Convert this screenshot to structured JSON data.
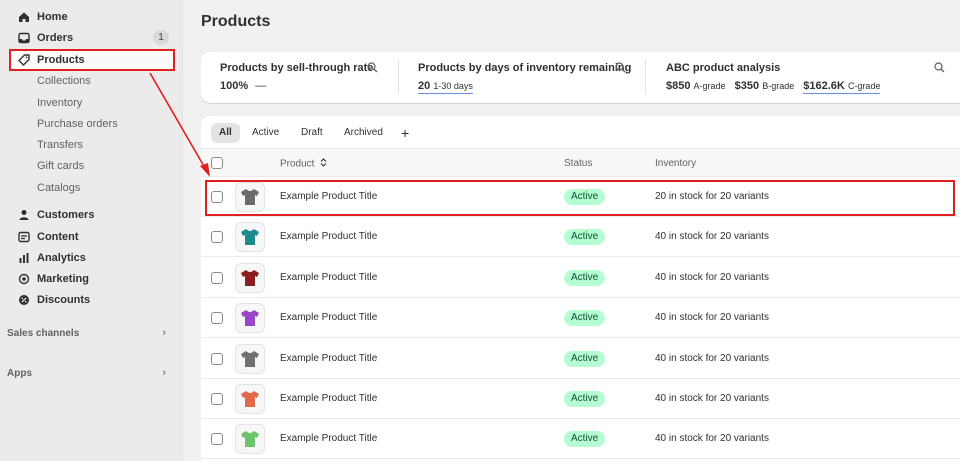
{
  "sidebar": {
    "home": "Home",
    "orders": "Orders",
    "orders_badge": "1",
    "products": "Products",
    "collections": "Collections",
    "inventory": "Inventory",
    "purchase_orders": "Purchase orders",
    "transfers": "Transfers",
    "gift_cards": "Gift cards",
    "catalogs": "Catalogs",
    "customers": "Customers",
    "content": "Content",
    "analytics": "Analytics",
    "marketing": "Marketing",
    "discounts": "Discounts",
    "sales_channels": "Sales channels",
    "apps": "Apps"
  },
  "page": {
    "title": "Products"
  },
  "metrics": {
    "sell_through": {
      "title": "Products by sell-through rate",
      "value": "100%",
      "trend": "—"
    },
    "days_inventory": {
      "title": "Products by days of inventory remaining",
      "value": "20",
      "range": "1-30 days"
    },
    "abc": {
      "title": "ABC product analysis",
      "a_value": "$850",
      "a_label": "A-grade",
      "b_value": "$350",
      "b_label": "B-grade",
      "c_value": "$162.6K",
      "c_label": "C-grade"
    }
  },
  "tabs": [
    "All",
    "Active",
    "Draft",
    "Archived"
  ],
  "tab_add": "+",
  "columns": {
    "product": "Product",
    "status": "Status",
    "inventory": "Inventory"
  },
  "rows": [
    {
      "title": "Example Product Title",
      "status": "Active",
      "inventory": "20 in stock for 20 variants",
      "color": "#6b6b6b"
    },
    {
      "title": "Example Product Title",
      "status": "Active",
      "inventory": "40 in stock for 20 variants",
      "color": "#1a8c8c"
    },
    {
      "title": "Example Product Title",
      "status": "Active",
      "inventory": "40 in stock for 20 variants",
      "color": "#8b1e1e"
    },
    {
      "title": "Example Product Title",
      "status": "Active",
      "inventory": "40 in stock for 20 variants",
      "color": "#9b45c9"
    },
    {
      "title": "Example Product Title",
      "status": "Active",
      "inventory": "40 in stock for 20 variants",
      "color": "#707070"
    },
    {
      "title": "Example Product Title",
      "status": "Active",
      "inventory": "40 in stock for 20 variants",
      "color": "#e06a4a"
    },
    {
      "title": "Example Product Title",
      "status": "Active",
      "inventory": "40 in stock for 20 variants",
      "color": "#6cc46c"
    }
  ],
  "colors": {
    "highlight": "#e02020",
    "status_bg": "#b4fed2",
    "status_text": "#0c5132"
  }
}
